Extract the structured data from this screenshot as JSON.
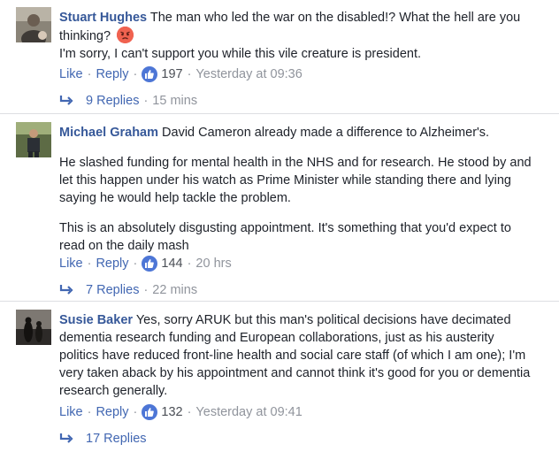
{
  "comments": [
    {
      "author": "Stuart Hughes",
      "text_lead": "The man who led the war on the disabled!? What the hell are you thinking?",
      "emoji": "angry-face-icon",
      "paragraphs": [
        "I'm sorry, I can't support you while this vile creature is president."
      ],
      "like_label": "Like",
      "reply_label": "Reply",
      "like_count": "197",
      "time": "Yesterday at 09:36",
      "replies_label": "9 Replies",
      "replies_time": "15 mins"
    },
    {
      "author": "Michael Graham",
      "text_lead": "David Cameron already made a difference to Alzheimer's.",
      "paragraphs": [
        "He slashed funding for mental health in the NHS and for research. He stood by and let this happen under his watch as Prime Minister while standing there and lying saying he would help tackle the problem.",
        "This is an absolutely disgusting appointment. It's something that you'd expect to read on the daily mash"
      ],
      "like_label": "Like",
      "reply_label": "Reply",
      "like_count": "144",
      "time": "20 hrs",
      "replies_label": "7 Replies",
      "replies_time": "22 mins"
    },
    {
      "author": "Susie Baker",
      "text_lead": "Yes, sorry ARUK but this man's political decisions have decimated dementia research funding and European collaborations, just as his austerity politics have reduced front-line health and social care staff (of which I am one); I'm very taken aback by his appointment and cannot think it's good for you or dementia research generally.",
      "paragraphs": [],
      "like_label": "Like",
      "reply_label": "Reply",
      "like_count": "132",
      "time": "Yesterday at 09:41",
      "replies_label": "17 Replies"
    }
  ],
  "colors": {
    "author": "#365899",
    "link": "#4267b2",
    "meta": "#90949c",
    "like_badge": "#4d76d6",
    "text": "#1d2129"
  }
}
